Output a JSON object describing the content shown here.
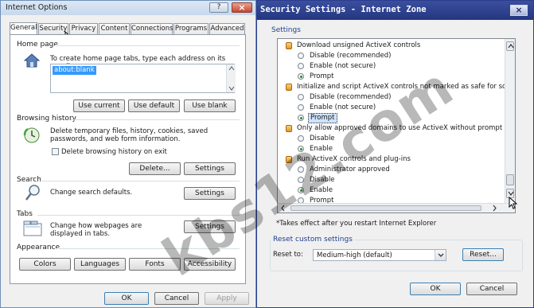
{
  "internet_options": {
    "title": "Internet Options",
    "help_glyph": "?",
    "close_glyph": "×",
    "tabs": [
      "General",
      "Security",
      "Privacy",
      "Content",
      "Connections",
      "Programs",
      "Advanced"
    ],
    "home_page": {
      "heading": "Home page",
      "description": "To create home page tabs, type each address on its own line.",
      "address": "about:blank",
      "use_current": "Use current",
      "use_default": "Use default",
      "use_blank": "Use blank"
    },
    "browsing_history": {
      "heading": "Browsing history",
      "description": "Delete temporary files, history, cookies, saved passwords, and web form information.",
      "checkbox_label": "Delete browsing history on exit",
      "delete_button": "Delete...",
      "settings_button": "Settings"
    },
    "search": {
      "heading": "Search",
      "description": "Change search defaults.",
      "settings_button": "Settings"
    },
    "tabs_section": {
      "heading": "Tabs",
      "description": "Change how webpages are displayed in tabs.",
      "settings_button": "Settings"
    },
    "appearance": {
      "heading": "Appearance",
      "colors": "Colors",
      "languages": "Languages",
      "fonts": "Fonts",
      "accessibility": "Accessibility"
    },
    "footer": {
      "ok": "OK",
      "cancel": "Cancel",
      "apply": "Apply"
    }
  },
  "security_settings": {
    "title": "Security Settings - Internet Zone",
    "close_glyph": "×",
    "settings_label": "Settings",
    "tree": [
      {
        "type": "heading",
        "label": "Download unsigned ActiveX controls"
      },
      {
        "type": "radio",
        "label": "Disable (recommended)",
        "checked": false
      },
      {
        "type": "radio",
        "label": "Enable (not secure)",
        "checked": false
      },
      {
        "type": "radio",
        "label": "Prompt",
        "checked": true
      },
      {
        "type": "heading",
        "label": "Initialize and script ActiveX controls not marked as safe for sc"
      },
      {
        "type": "radio",
        "label": "Disable (recommended)",
        "checked": false
      },
      {
        "type": "radio",
        "label": "Enable (not secure)",
        "checked": false
      },
      {
        "type": "radio",
        "label": "Prompt",
        "checked": true,
        "selected": true
      },
      {
        "type": "heading",
        "label": "Only allow approved domains to use ActiveX without prompt"
      },
      {
        "type": "radio",
        "label": "Disable",
        "checked": false
      },
      {
        "type": "radio",
        "label": "Enable",
        "checked": true
      },
      {
        "type": "heading",
        "label": "Run ActiveX controls and plug-ins"
      },
      {
        "type": "radio",
        "label": "Administrator approved",
        "checked": false
      },
      {
        "type": "radio",
        "label": "Disable",
        "checked": false
      },
      {
        "type": "radio",
        "label": "Enable",
        "checked": true
      },
      {
        "type": "radio",
        "label": "Prompt",
        "checked": false
      }
    ],
    "note": "*Takes effect after you restart Internet Explorer",
    "reset_group_label": "Reset custom settings",
    "reset_to_label": "Reset to:",
    "reset_level": "Medium-high (default)",
    "reset_button": "Reset...",
    "ok": "OK",
    "cancel": "Cancel"
  },
  "watermark": "kbs12.com",
  "colors": {
    "title_bar_right": "#2b3d8f",
    "selection": "#3399ff",
    "accent_border": "#3c7fb1"
  }
}
